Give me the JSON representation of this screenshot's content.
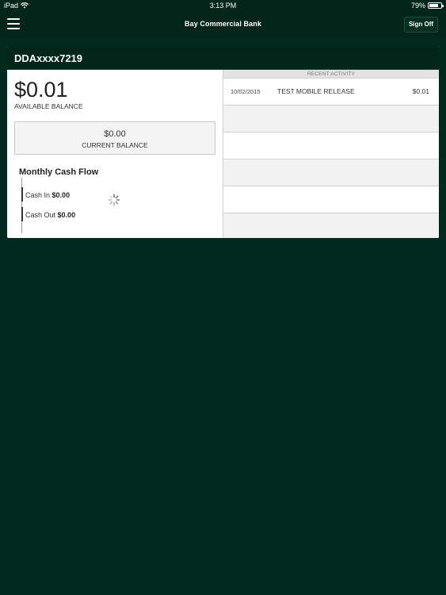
{
  "status_bar": {
    "device": "iPad",
    "time": "3:13 PM",
    "battery": "79%",
    "battery_level": 0.79
  },
  "navbar": {
    "title": "Bay Commercial Bank",
    "sign_off_label": "Sign Off"
  },
  "account": {
    "name": "DDAxxxx7219",
    "available_balance": "$0.01",
    "available_label": "AVAILABLE BALANCE",
    "current_balance": "$0.00",
    "current_label": "CURRENT BALANCE",
    "cash_flow": {
      "title": "Monthly Cash Flow",
      "cash_in_label": "Cash In",
      "cash_in_value": "$0.00",
      "cash_out_label": "Cash Out",
      "cash_out_value": "$0.00"
    }
  },
  "recent_activity": {
    "header": "RECENT ACTIVITY",
    "rows": [
      {
        "date": "10/02/2015",
        "description": "TEST MOBILE RELEASE",
        "amount": "$0.01"
      },
      {
        "date": "",
        "description": "",
        "amount": ""
      },
      {
        "date": "",
        "description": "",
        "amount": ""
      },
      {
        "date": "",
        "description": "",
        "amount": ""
      },
      {
        "date": "",
        "description": "",
        "amount": ""
      },
      {
        "date": "",
        "description": "",
        "amount": ""
      }
    ]
  },
  "icons": {
    "menu": "hamburger-menu-icon",
    "wifi": "wifi-icon",
    "battery": "battery-icon",
    "loading": "loading-spinner-icon"
  }
}
